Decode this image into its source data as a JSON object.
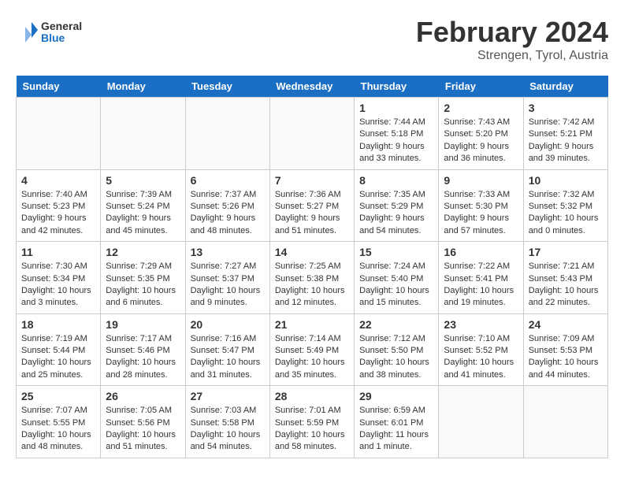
{
  "header": {
    "logo_general": "General",
    "logo_blue": "Blue",
    "title": "February 2024",
    "subtitle": "Strengen, Tyrol, Austria"
  },
  "days_of_week": [
    "Sunday",
    "Monday",
    "Tuesday",
    "Wednesday",
    "Thursday",
    "Friday",
    "Saturday"
  ],
  "weeks": [
    [
      {
        "num": "",
        "info": ""
      },
      {
        "num": "",
        "info": ""
      },
      {
        "num": "",
        "info": ""
      },
      {
        "num": "",
        "info": ""
      },
      {
        "num": "1",
        "info": "Sunrise: 7:44 AM\nSunset: 5:18 PM\nDaylight: 9 hours\nand 33 minutes."
      },
      {
        "num": "2",
        "info": "Sunrise: 7:43 AM\nSunset: 5:20 PM\nDaylight: 9 hours\nand 36 minutes."
      },
      {
        "num": "3",
        "info": "Sunrise: 7:42 AM\nSunset: 5:21 PM\nDaylight: 9 hours\nand 39 minutes."
      }
    ],
    [
      {
        "num": "4",
        "info": "Sunrise: 7:40 AM\nSunset: 5:23 PM\nDaylight: 9 hours\nand 42 minutes."
      },
      {
        "num": "5",
        "info": "Sunrise: 7:39 AM\nSunset: 5:24 PM\nDaylight: 9 hours\nand 45 minutes."
      },
      {
        "num": "6",
        "info": "Sunrise: 7:37 AM\nSunset: 5:26 PM\nDaylight: 9 hours\nand 48 minutes."
      },
      {
        "num": "7",
        "info": "Sunrise: 7:36 AM\nSunset: 5:27 PM\nDaylight: 9 hours\nand 51 minutes."
      },
      {
        "num": "8",
        "info": "Sunrise: 7:35 AM\nSunset: 5:29 PM\nDaylight: 9 hours\nand 54 minutes."
      },
      {
        "num": "9",
        "info": "Sunrise: 7:33 AM\nSunset: 5:30 PM\nDaylight: 9 hours\nand 57 minutes."
      },
      {
        "num": "10",
        "info": "Sunrise: 7:32 AM\nSunset: 5:32 PM\nDaylight: 10 hours\nand 0 minutes."
      }
    ],
    [
      {
        "num": "11",
        "info": "Sunrise: 7:30 AM\nSunset: 5:34 PM\nDaylight: 10 hours\nand 3 minutes."
      },
      {
        "num": "12",
        "info": "Sunrise: 7:29 AM\nSunset: 5:35 PM\nDaylight: 10 hours\nand 6 minutes."
      },
      {
        "num": "13",
        "info": "Sunrise: 7:27 AM\nSunset: 5:37 PM\nDaylight: 10 hours\nand 9 minutes."
      },
      {
        "num": "14",
        "info": "Sunrise: 7:25 AM\nSunset: 5:38 PM\nDaylight: 10 hours\nand 12 minutes."
      },
      {
        "num": "15",
        "info": "Sunrise: 7:24 AM\nSunset: 5:40 PM\nDaylight: 10 hours\nand 15 minutes."
      },
      {
        "num": "16",
        "info": "Sunrise: 7:22 AM\nSunset: 5:41 PM\nDaylight: 10 hours\nand 19 minutes."
      },
      {
        "num": "17",
        "info": "Sunrise: 7:21 AM\nSunset: 5:43 PM\nDaylight: 10 hours\nand 22 minutes."
      }
    ],
    [
      {
        "num": "18",
        "info": "Sunrise: 7:19 AM\nSunset: 5:44 PM\nDaylight: 10 hours\nand 25 minutes."
      },
      {
        "num": "19",
        "info": "Sunrise: 7:17 AM\nSunset: 5:46 PM\nDaylight: 10 hours\nand 28 minutes."
      },
      {
        "num": "20",
        "info": "Sunrise: 7:16 AM\nSunset: 5:47 PM\nDaylight: 10 hours\nand 31 minutes."
      },
      {
        "num": "21",
        "info": "Sunrise: 7:14 AM\nSunset: 5:49 PM\nDaylight: 10 hours\nand 35 minutes."
      },
      {
        "num": "22",
        "info": "Sunrise: 7:12 AM\nSunset: 5:50 PM\nDaylight: 10 hours\nand 38 minutes."
      },
      {
        "num": "23",
        "info": "Sunrise: 7:10 AM\nSunset: 5:52 PM\nDaylight: 10 hours\nand 41 minutes."
      },
      {
        "num": "24",
        "info": "Sunrise: 7:09 AM\nSunset: 5:53 PM\nDaylight: 10 hours\nand 44 minutes."
      }
    ],
    [
      {
        "num": "25",
        "info": "Sunrise: 7:07 AM\nSunset: 5:55 PM\nDaylight: 10 hours\nand 48 minutes."
      },
      {
        "num": "26",
        "info": "Sunrise: 7:05 AM\nSunset: 5:56 PM\nDaylight: 10 hours\nand 51 minutes."
      },
      {
        "num": "27",
        "info": "Sunrise: 7:03 AM\nSunset: 5:58 PM\nDaylight: 10 hours\nand 54 minutes."
      },
      {
        "num": "28",
        "info": "Sunrise: 7:01 AM\nSunset: 5:59 PM\nDaylight: 10 hours\nand 58 minutes."
      },
      {
        "num": "29",
        "info": "Sunrise: 6:59 AM\nSunset: 6:01 PM\nDaylight: 11 hours\nand 1 minute."
      },
      {
        "num": "",
        "info": ""
      },
      {
        "num": "",
        "info": ""
      }
    ]
  ]
}
